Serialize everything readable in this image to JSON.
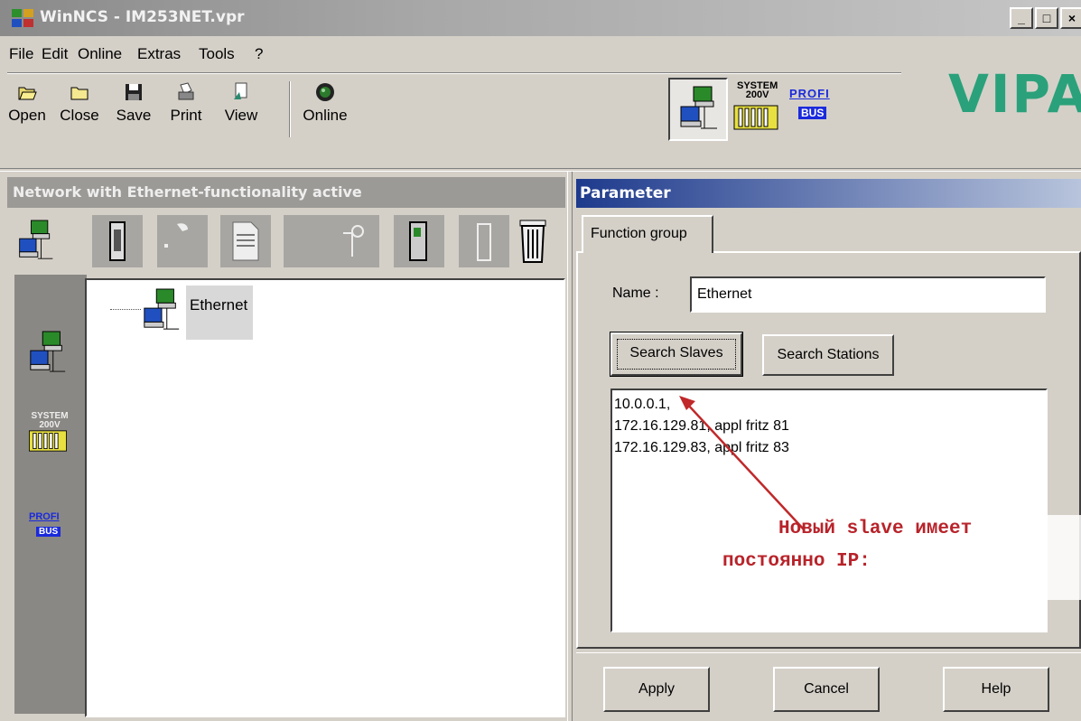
{
  "window": {
    "title": "WinNCS - IM253NET.vpr",
    "minimize_glyph": "_",
    "maximize_glyph": "□",
    "close_glyph": "×"
  },
  "menu": {
    "items": [
      {
        "label": "File",
        "hotkey": "F"
      },
      {
        "label": "Edit",
        "hotkey": "E"
      },
      {
        "label": "Online",
        "hotkey": "O"
      },
      {
        "label": "Extras",
        "hotkey": "E"
      },
      {
        "label": "Tools",
        "hotkey": ""
      },
      {
        "label": "?",
        "hotkey": "?"
      }
    ]
  },
  "toolbar": {
    "open": "Open",
    "close": "Close",
    "save": "Save",
    "print": "Print",
    "view": "View",
    "online": "Online"
  },
  "brand": {
    "logo": "VIPA",
    "logo_color": "#2aa17a",
    "system_badge_line1": "SYSTEM",
    "system_badge_line2": "200V",
    "profibus_line1": "PROFI",
    "profibus_line2": "BUS"
  },
  "left_panel": {
    "title": "Network with Ethernet-functionality active",
    "tree_node": "Ethernet"
  },
  "parameter": {
    "header": "Parameter",
    "tab": "Function group",
    "name_label": "Name :",
    "name_value": "Ethernet",
    "search_slaves": "Search Slaves",
    "search_stations": "Search Stations",
    "slaves": [
      "10.0.0.1,",
      "172.16.129.81, appl fritz 81",
      "172.16.129.83, appl fritz 83"
    ],
    "annotation_line1": "Новый slave имеет",
    "annotation_line2": "постоянно IP:",
    "annotation_color": "#b8232a",
    "apply": "Apply",
    "cancel": "Cancel",
    "help": "Help"
  }
}
